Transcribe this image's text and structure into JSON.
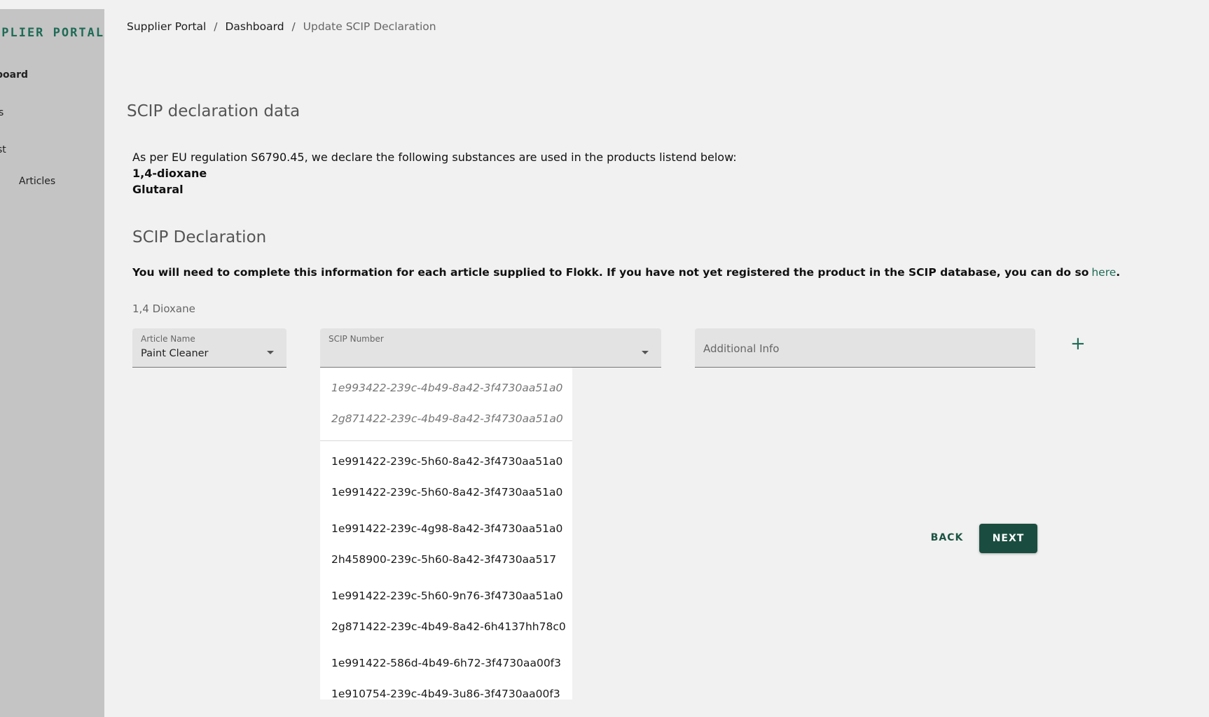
{
  "sidebar": {
    "brand": "PPLIER PORTAL",
    "items": [
      {
        "label": "board",
        "active": true
      },
      {
        "label": "s"
      },
      {
        "label": "st"
      },
      {
        "label": "Articles"
      }
    ]
  },
  "breadcrumb": {
    "root": "Supplier Portal",
    "parent": "Dashboard",
    "current": "Update SCIP Declaration",
    "separator": "/"
  },
  "declaration_data": {
    "title": "SCIP declaration data",
    "intro": "As per EU regulation S6790.45, we declare the following substances are used in the products listend below:",
    "substances": [
      "1,4-dioxane",
      "Glutaral"
    ]
  },
  "scip_declaration": {
    "title": "SCIP Declaration",
    "instruction": "You will need to complete this information for each article supplied to Flokk. If you have not yet registered the product in the SCIP database, you can do so",
    "link_text": "here",
    "link_suffix": ".",
    "substance_label": "1,4 Dioxane"
  },
  "form": {
    "article_name": {
      "label": "Article Name",
      "value": "Paint Cleaner"
    },
    "scip_number": {
      "label": "SCIP Number",
      "value": ""
    },
    "additional_info": {
      "placeholder": "Additional Info"
    },
    "add_icon": "plus-icon"
  },
  "dropdown": {
    "recent": [
      "1e993422-239c-4b49-8a42-3f4730aa51a0",
      "2g871422-239c-4b49-8a42-3f4730aa51a0"
    ],
    "options": [
      "1e991422-239c-5h60-8a42-3f4730aa51a0",
      "1e991422-239c-5h60-8a42-3f4730aa51a0",
      "1e991422-239c-4g98-8a42-3f4730aa51a0",
      "2h458900-239c-5h60-8a42-3f4730aa517",
      "1e991422-239c-5h60-9n76-3f4730aa51a0",
      "2g871422-239c-4b49-8a42-6h4137hh78c0",
      "1e991422-586d-4b49-6h72-3f4730aa00f3",
      "1e910754-239c-4b49-3u86-3f4730aa00f3"
    ]
  },
  "actions": {
    "back": "BACK",
    "next": "NEXT"
  },
  "colors": {
    "accent": "#1f6b56",
    "primary_button": "#1a4d3f",
    "sidebar_bg": "#c4c4c4",
    "page_bg": "#f1f1f1"
  }
}
